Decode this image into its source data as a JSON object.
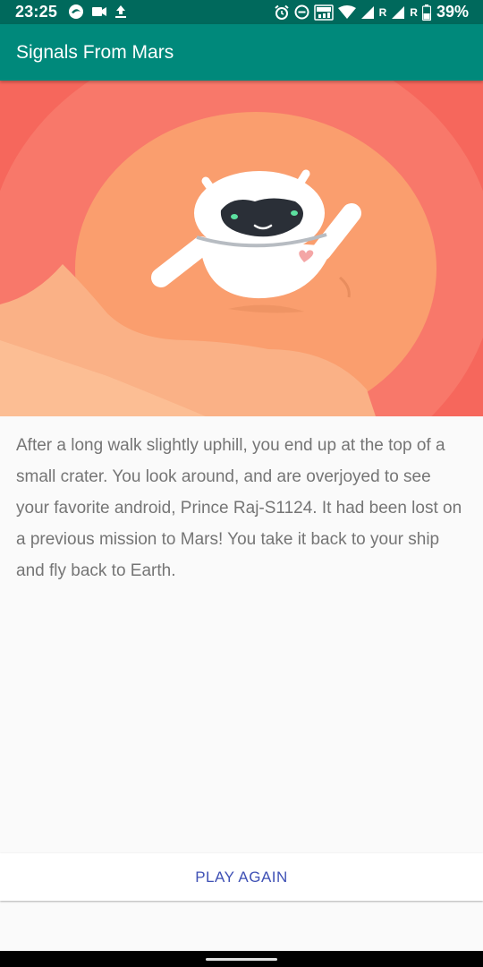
{
  "status_bar": {
    "time": "23:25",
    "network_label_1": "R",
    "network_label_2": "R",
    "battery_percent": "39%",
    "icons_left": [
      "browser-icon",
      "video-camera-icon",
      "upload-icon"
    ],
    "icons_right": [
      "alarm-icon",
      "do-not-disturb-icon",
      "volte-icon",
      "wifi-icon",
      "signal-icon",
      "signal-icon",
      "battery-icon"
    ]
  },
  "app_bar": {
    "title": "Signals From Mars"
  },
  "hero": {
    "image": "android-robot-on-mars-illustration"
  },
  "story": {
    "text": "After a long walk slightly uphill, you end up at the top of a small crater. You look around, and are overjoyed to see your favorite android, Prince Raj-S1124. It had been lost on a previous mission to Mars! You take it back to your ship and fly back to Earth."
  },
  "actions": {
    "play_again_label": "PLAY AGAIN"
  },
  "colors": {
    "status_bar": "#00695c",
    "app_bar": "#00897b",
    "button_text": "#3f51b5",
    "story_text": "#757575",
    "background": "#fafafa"
  }
}
